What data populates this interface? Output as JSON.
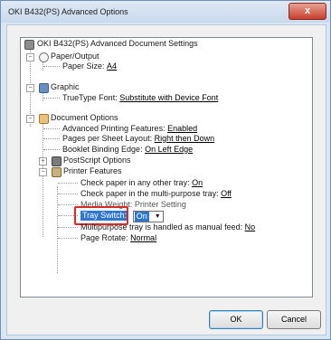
{
  "window": {
    "title": "OKI B432(PS) Advanced Options",
    "close_glyph": "x"
  },
  "tree": {
    "root": "OKI B432(PS) Advanced Document Settings",
    "paper_output": "Paper/Output",
    "paper_size_label": "Paper Size:",
    "paper_size_value": "A4",
    "graphic": "Graphic",
    "truetype_label": "TrueType Font:",
    "truetype_value": "Substitute with Device Font",
    "document_options": "Document Options",
    "adv_printing_label": "Advanced Printing Features:",
    "adv_printing_value": "Enabled",
    "pages_per_sheet_label": "Pages per Sheet Layout:",
    "pages_per_sheet_value": "Right then Down",
    "booklet_label": "Booklet Binding Edge:",
    "booklet_value": "On Left Edge",
    "postscript_options": "PostScript Options",
    "printer_features": "Printer Features",
    "check_paper_other_label": "Check paper in any other tray:",
    "check_paper_other_value": "On",
    "check_paper_multi_label": "Check paper in the multi-purpose tray:",
    "check_paper_multi_value": "Off",
    "media_weight_partial": "Media Weight: Printer Setting",
    "tray_switch_label": "Tray Switch:",
    "tray_switch_value": "On",
    "multipurpose_label": "Multipurpose tray is handled as manual feed:",
    "multipurpose_value": "No",
    "page_rotate_label": "Page Rotate:",
    "page_rotate_value": "Normal"
  },
  "buttons": {
    "ok": "OK",
    "cancel": "Cancel"
  },
  "icons": {
    "expand_minus": "−",
    "expand_plus": "+",
    "dropdown_arrow": "▼"
  },
  "colors": {
    "highlight": "#d52b2b",
    "selection": "#2f76cf"
  }
}
